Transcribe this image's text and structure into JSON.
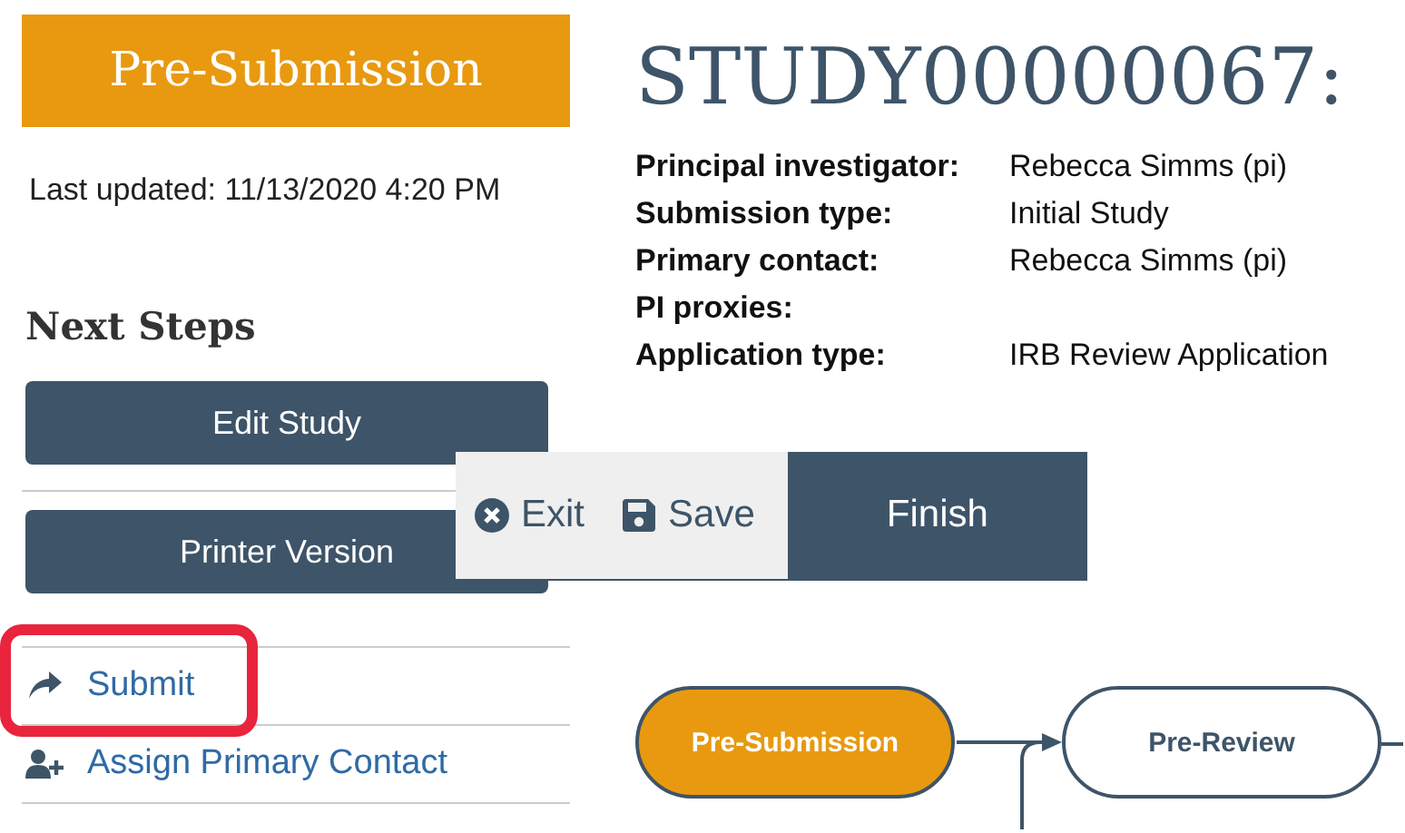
{
  "status": {
    "label": "Pre-Submission"
  },
  "last_updated": "Last updated: 11/13/2020 4:20 PM",
  "next_steps": {
    "heading": "Next Steps",
    "items": [
      {
        "kind": "button",
        "label": "Edit Study",
        "highlighted": false
      },
      {
        "kind": "button",
        "label": "Printer Version",
        "highlighted": false
      },
      {
        "kind": "submit-link",
        "label": "Submit",
        "highlighted": true
      },
      {
        "kind": "assign-link",
        "label": "Assign Primary Contact",
        "highlighted": false
      }
    ]
  },
  "title": "STUDY00000067:",
  "details": [
    {
      "label": "Principal investigator:",
      "value": "Rebecca Simms (pi)"
    },
    {
      "label": "Submission type:",
      "value": "Initial Study"
    },
    {
      "label": "Primary contact:",
      "value": "Rebecca Simms (pi)"
    },
    {
      "label": "PI proxies:"
    },
    {
      "label": "Application type:",
      "value": "IRB Review Application"
    }
  ],
  "toolbar": [
    {
      "kind": "exit",
      "label": "Exit"
    },
    {
      "kind": "save",
      "label": "Save"
    },
    {
      "kind": "primary",
      "label": "Finish"
    }
  ],
  "workflow": [
    {
      "label": "Pre-Submission",
      "selected": true
    },
    {
      "label": "Pre-Review",
      "selected": false
    }
  ]
}
